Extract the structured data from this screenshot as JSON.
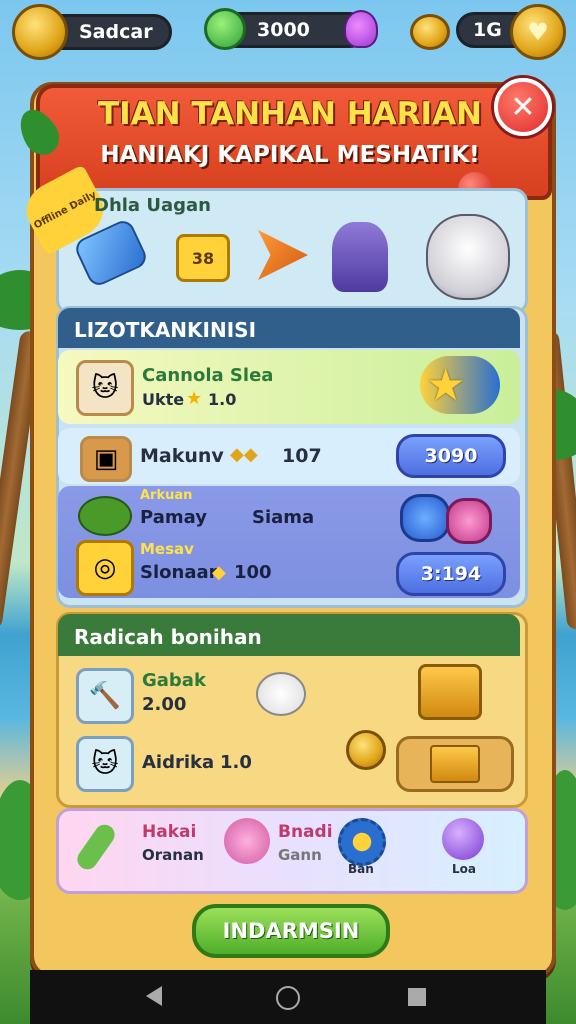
{
  "topbar": {
    "player_name": "Sadcar",
    "gems": "3000",
    "level": "1G"
  },
  "banner": {
    "title": "TIAN TANHAN HARIAN",
    "subtitle": "HANIAKJ KAPIKAL MESHATIK!"
  },
  "tag": {
    "label": "Offline Daily"
  },
  "rewards_strip": {
    "title": "Dhla Uagan",
    "badge": "38"
  },
  "section1": {
    "header": "LIZOTKANKINISI",
    "row1": {
      "name": "Cannola Slea",
      "sub": "Ukte",
      "value": "1.0"
    },
    "row2": {
      "name": "Makunv",
      "value": "107",
      "button": "3090"
    },
    "row3": {
      "label": "Arkuan",
      "name": "Pamay",
      "sub": "Siama"
    },
    "row4": {
      "label": "Mesav",
      "name": "Slonaar",
      "value": "100",
      "button": "3:194"
    }
  },
  "section2": {
    "header": "Radicah bonihan",
    "row1": {
      "name": "Gabak",
      "value": "2.00"
    },
    "row2": {
      "name": "Aidrika",
      "value": "1.0"
    }
  },
  "section3": {
    "item1": {
      "name": "Hakai",
      "sub": "Oranan"
    },
    "item2": {
      "name": "Bnadi",
      "sub": "Gann"
    },
    "item3": {
      "sub": "Ban"
    },
    "item4": {
      "sub": "Loa"
    }
  },
  "bottom_button": "INDARMSIN",
  "colors": {
    "accent": "#f15b3a",
    "panel": "#f3c65e",
    "button_blue": "#4d6fe0",
    "button_green": "#4fae2a"
  }
}
